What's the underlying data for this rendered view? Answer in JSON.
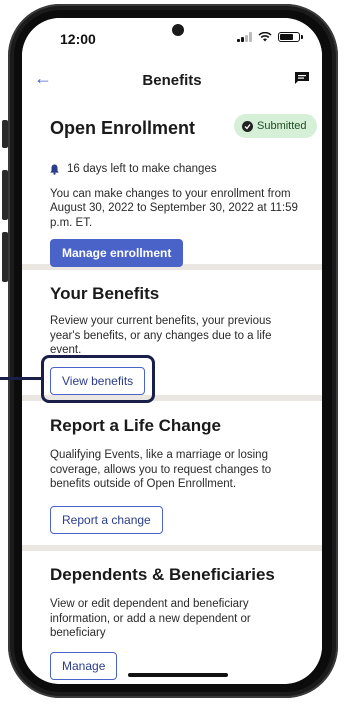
{
  "status_bar": {
    "time": "12:00",
    "battery_level": 0.8
  },
  "nav": {
    "title": "Benefits",
    "back_icon": "arrow-left-icon",
    "chat_icon": "chat-icon"
  },
  "open_enrollment": {
    "title": "Open Enrollment",
    "badge": "Submitted",
    "reminder": "16 days left to make changes",
    "description": "You can make changes to your enrollment from August 30, 2022 to September 30, 2022 at 11:59 p.m. ET.",
    "button": "Manage enrollment"
  },
  "your_benefits": {
    "title": "Your Benefits",
    "description": "Review your current benefits, your previous year's benefits, or any changes due to a life event.",
    "button": "View benefits"
  },
  "life_change": {
    "title": "Report a Life Change",
    "description": "Qualifying Events, like a marriage or losing coverage, allows you to request changes to benefits outside of Open Enrollment.",
    "button": "Report a change"
  },
  "dependents": {
    "title": "Dependents & Beneficiaries",
    "description": "View or edit dependent and beneficiary information, or add a new dependent or beneficiary",
    "button": "Manage"
  },
  "colors": {
    "accent": "#4a63c8",
    "badge_bg": "#d6f0d8",
    "highlight": "#1a1f4a",
    "divider": "#eae6e1"
  }
}
